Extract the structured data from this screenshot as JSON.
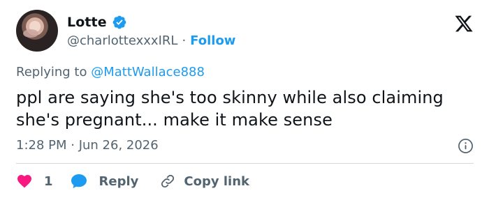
{
  "author": {
    "display_name": "Lotte",
    "handle": "@charlottexxxIRL",
    "separator": "·",
    "follow_label": "Follow"
  },
  "replying": {
    "prefix": "Replying to",
    "mention": "@MattWallace888"
  },
  "tweet": {
    "line1": "ppl are saying she's too skinny while also claiming",
    "line2": "she's pregnant... make it make sense"
  },
  "timestamp": "1:28 PM · Jun 26, 2026",
  "actions": {
    "like_count": "1",
    "reply_label": "Reply",
    "copy_label": "Copy link"
  },
  "icons": {
    "verified": "verified-badge-icon",
    "logo": "x-logo-icon",
    "info": "info-icon",
    "like": "heart-icon",
    "reply": "speech-bubble-icon",
    "copy": "link-icon"
  },
  "colors": {
    "accent": "#1d9bf0",
    "like": "#f91880",
    "secondary_text": "#536471",
    "primary_text": "#0f1419"
  }
}
